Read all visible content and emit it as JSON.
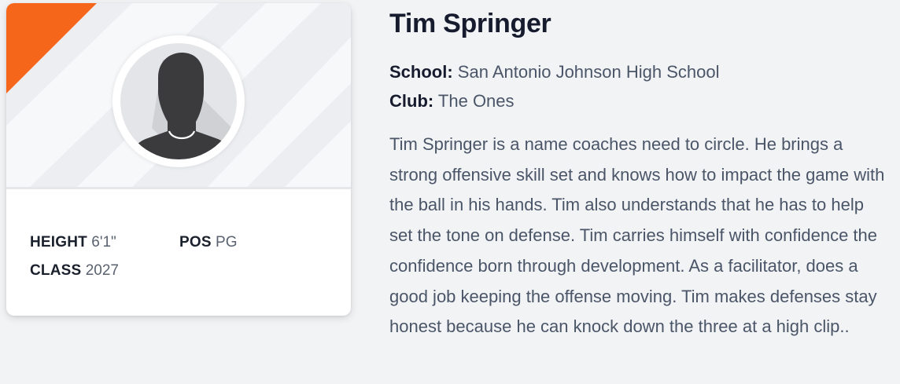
{
  "player": {
    "name": "Tim Springer",
    "school_label": "School:",
    "school": "San Antonio Johnson High School",
    "club_label": "Club:",
    "club": "The Ones",
    "bio": "Tim Springer is a name coaches need to circle. He brings a strong offensive skill set and knows how to impact the game with the ball in his hands. Tim also understands that he has to help set the tone on defense. Tim carries himself with confidence the confidence born through development. As a facilitator, does a good job keeping the offense moving. Tim makes defenses stay honest because he can knock down the three at a high clip.."
  },
  "card": {
    "avatar_icon": "person-silhouette-icon",
    "stats": {
      "height_label": "HEIGHT",
      "height": "6'1\"",
      "pos_label": "POS",
      "pos": "PG",
      "class_label": "CLASS",
      "class": "2027"
    },
    "accent_color": "#f5661a"
  }
}
